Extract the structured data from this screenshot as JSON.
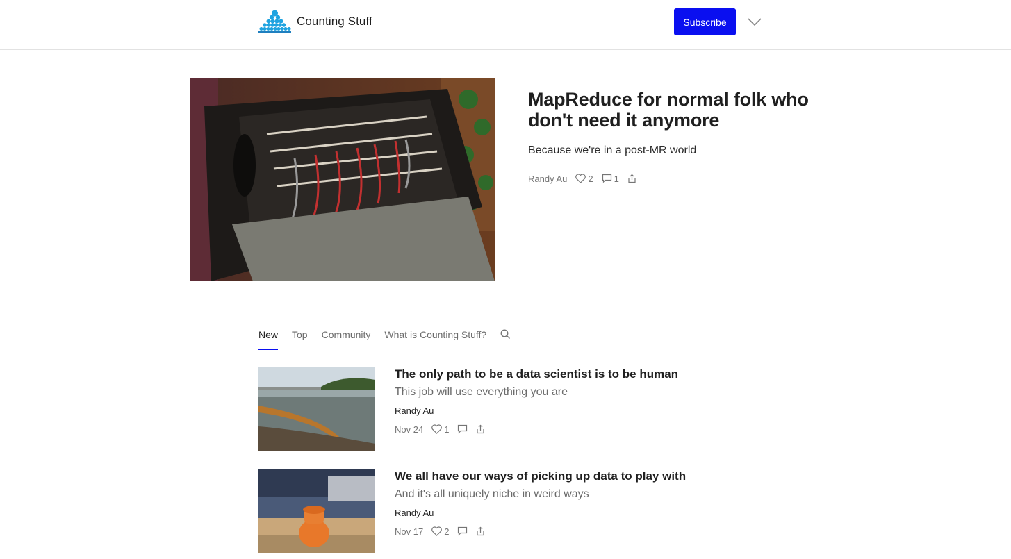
{
  "header": {
    "publication_name": "Counting Stuff",
    "subscribe_label": "Subscribe",
    "menu_icon": "chevron-down-icon",
    "logo_icon": "stacked-dots-logo",
    "accent_color": "#0a0ff0"
  },
  "hero": {
    "title": "MapReduce for normal folk who don't need it anymore",
    "subtitle": "Because we're in a post-MR world",
    "author": "Randy Au",
    "likes": "2",
    "comments": "1",
    "image_description": "vintage telephone switchboard"
  },
  "tabs": [
    {
      "label": "New",
      "active": true
    },
    {
      "label": "Top",
      "active": false
    },
    {
      "label": "Community",
      "active": false
    },
    {
      "label": "What is Counting Stuff?",
      "active": false
    }
  ],
  "posts": [
    {
      "title": "The only path to be a data scientist is to be human",
      "subtitle": "This job will use everything you are",
      "author": "Randy Au",
      "date": "Nov 24",
      "likes": "1",
      "comments": ""
    },
    {
      "title": "We all have our ways of picking up data to play with",
      "subtitle": "And it's all uniquely niche in weird ways",
      "author": "Randy Au",
      "date": "Nov 17",
      "likes": "2",
      "comments": ""
    }
  ]
}
